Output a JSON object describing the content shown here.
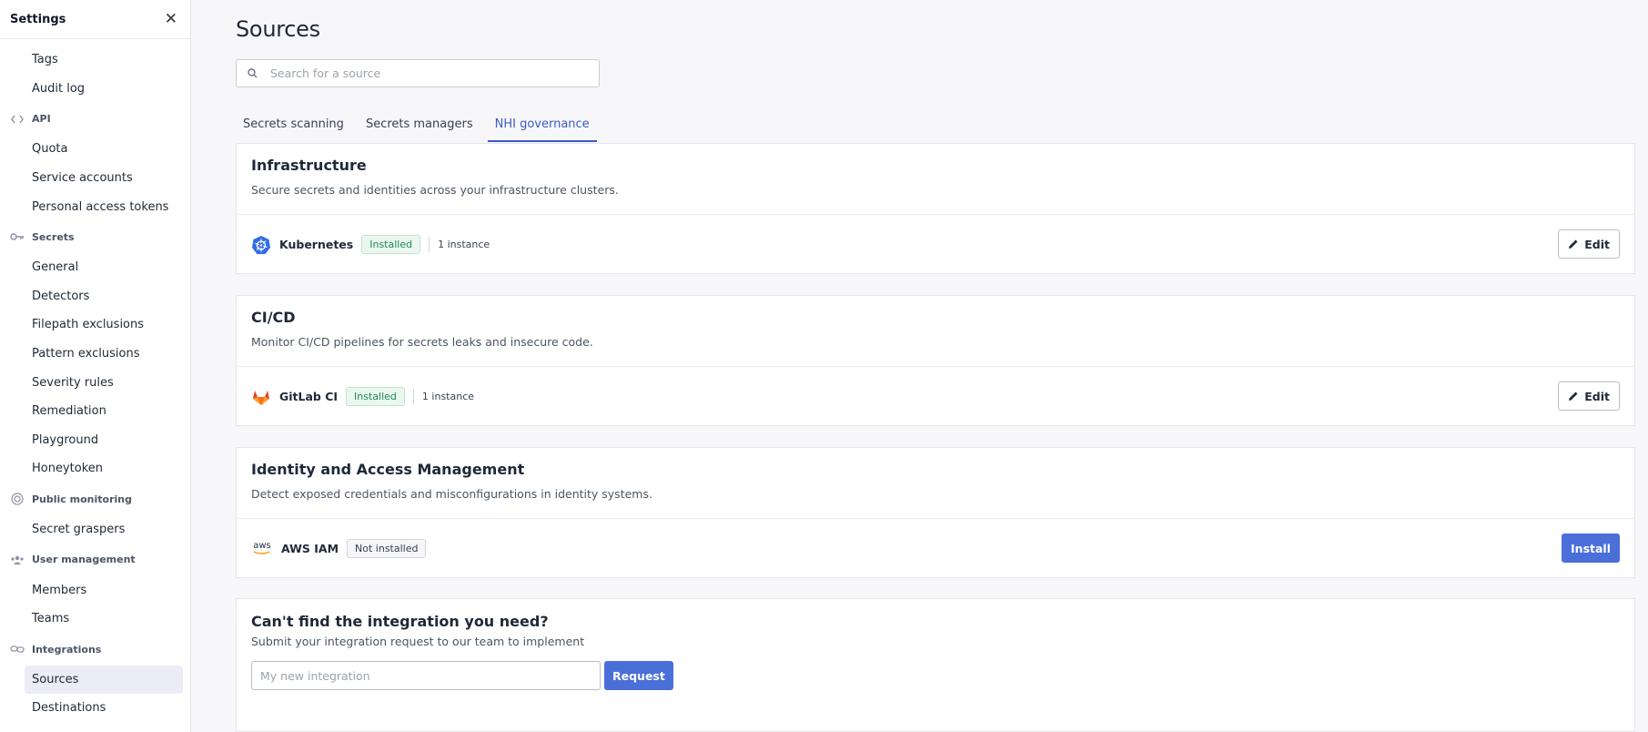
{
  "sidebar": {
    "title": "Settings",
    "close_icon": "close-icon",
    "items": [
      {
        "type": "item",
        "label": "Tags"
      },
      {
        "type": "item",
        "label": "Audit log"
      },
      {
        "type": "section",
        "label": "API",
        "icon": "code-icon"
      },
      {
        "type": "item",
        "label": "Quota"
      },
      {
        "type": "item",
        "label": "Service accounts"
      },
      {
        "type": "item",
        "label": "Personal access tokens"
      },
      {
        "type": "section",
        "label": "Secrets",
        "icon": "key-icon"
      },
      {
        "type": "item",
        "label": "General"
      },
      {
        "type": "item",
        "label": "Detectors"
      },
      {
        "type": "item",
        "label": "Filepath exclusions"
      },
      {
        "type": "item",
        "label": "Pattern exclusions"
      },
      {
        "type": "item",
        "label": "Severity rules"
      },
      {
        "type": "item",
        "label": "Remediation"
      },
      {
        "type": "item",
        "label": "Playground"
      },
      {
        "type": "item",
        "label": "Honeytoken"
      },
      {
        "type": "section",
        "label": "Public monitoring",
        "icon": "radar-icon"
      },
      {
        "type": "item",
        "label": "Secret graspers"
      },
      {
        "type": "section",
        "label": "User management",
        "icon": "users-icon"
      },
      {
        "type": "item",
        "label": "Members"
      },
      {
        "type": "item",
        "label": "Teams"
      },
      {
        "type": "section",
        "label": "Integrations",
        "icon": "link-icon"
      },
      {
        "type": "item",
        "label": "Sources",
        "active": true
      },
      {
        "type": "item",
        "label": "Destinations"
      }
    ]
  },
  "main": {
    "title": "Sources",
    "search": {
      "placeholder": "Search for a source",
      "value": ""
    },
    "tabs": [
      {
        "label": "Secrets scanning",
        "active": false
      },
      {
        "label": "Secrets managers",
        "active": false
      },
      {
        "label": "NHI governance",
        "active": true
      }
    ],
    "cards": [
      {
        "title": "Infrastructure",
        "description": "Secure secrets and identities across your infrastructure clusters.",
        "integration": {
          "name": "Kubernetes",
          "logo": "kubernetes-icon",
          "status": "Installed",
          "instances": "1 instance",
          "action": "Edit"
        }
      },
      {
        "title": "CI/CD",
        "description": "Monitor CI/CD pipelines for secrets leaks and insecure code.",
        "integration": {
          "name": "GitLab CI",
          "logo": "gitlab-icon",
          "status": "Installed",
          "instances": "1 instance",
          "action": "Edit"
        }
      },
      {
        "title": "Identity and Access Management",
        "description": "Detect exposed credentials and misconfigurations in identity systems.",
        "integration": {
          "name": "AWS IAM",
          "logo": "aws-icon",
          "logo_text": "aws",
          "status": "Not installed",
          "instances": "",
          "action": "Install"
        }
      }
    ],
    "request": {
      "title": "Can't find the integration you need?",
      "description": "Submit your integration request to our team to implement",
      "placeholder": "My new integration",
      "button": "Request"
    }
  },
  "colors": {
    "accent": "#3b5bc7",
    "primary_button": "#4a6fd9",
    "installed_green": "#1f8a50"
  }
}
